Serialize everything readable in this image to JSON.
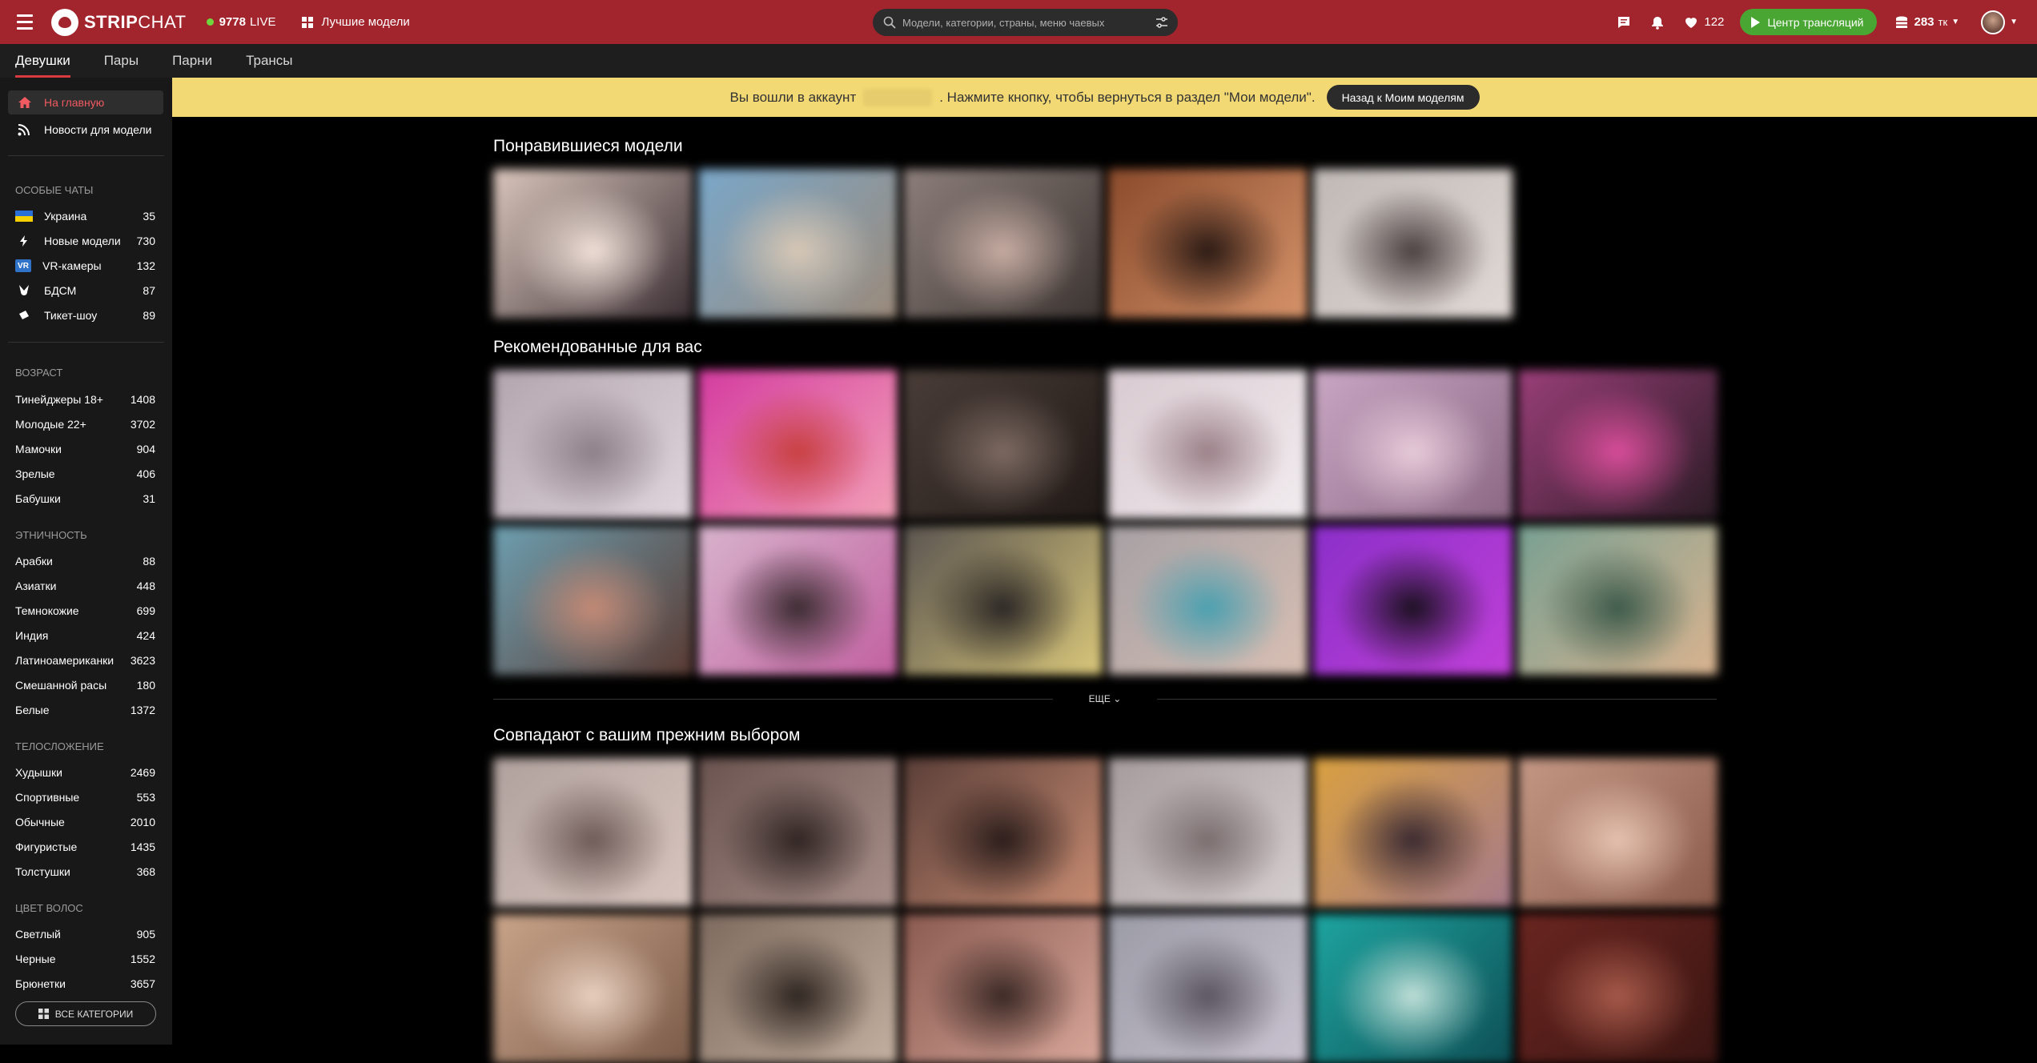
{
  "header": {
    "brand_bold": "STRIP",
    "brand_rest": "CHAT",
    "live_count": "9778",
    "live_label": "LIVE",
    "top_models": "Лучшие модели",
    "search_placeholder": "Модели, категории, страны, меню чаевых",
    "favorites_count": "122",
    "broadcast_button": "Центр трансляций",
    "tokens_count": "283",
    "tokens_unit": "тк"
  },
  "subnav": {
    "tabs": [
      "Девушки",
      "Пары",
      "Парни",
      "Трансы"
    ],
    "active": 0
  },
  "sidebar": {
    "home": "На главную",
    "news": "Новости для модели",
    "special_header": "Особые чаты",
    "special": [
      {
        "label": "Украина",
        "count": "35",
        "icon": "ukraine-flag-icon"
      },
      {
        "label": "Новые модели",
        "count": "730",
        "icon": "lightning-icon"
      },
      {
        "label": "VR-камеры",
        "count": "132",
        "icon": "vr-icon"
      },
      {
        "label": "БДСМ",
        "count": "87",
        "icon": "bdsm-icon"
      },
      {
        "label": "Тикет-шоу",
        "count": "89",
        "icon": "ticket-icon"
      }
    ],
    "age_header": "Возраст",
    "age": [
      {
        "label": "Тинейджеры 18+",
        "count": "1408"
      },
      {
        "label": "Молодые 22+",
        "count": "3702"
      },
      {
        "label": "Мамочки",
        "count": "904"
      },
      {
        "label": "Зрелые",
        "count": "406"
      },
      {
        "label": "Бабушки",
        "count": "31"
      }
    ],
    "ethnicity_header": "Этничность",
    "ethnicity": [
      {
        "label": "Арабки",
        "count": "88"
      },
      {
        "label": "Азиатки",
        "count": "448"
      },
      {
        "label": "Темнокожие",
        "count": "699"
      },
      {
        "label": "Индия",
        "count": "424"
      },
      {
        "label": "Латиноамериканки",
        "count": "3623"
      },
      {
        "label": "Смешанной расы",
        "count": "180"
      },
      {
        "label": "Белые",
        "count": "1372"
      }
    ],
    "body_header": "Телосложение",
    "body": [
      {
        "label": "Худышки",
        "count": "2469"
      },
      {
        "label": "Спортивные",
        "count": "553"
      },
      {
        "label": "Обычные",
        "count": "2010"
      },
      {
        "label": "Фигуристые",
        "count": "1435"
      },
      {
        "label": "Толстушки",
        "count": "368"
      }
    ],
    "hair_header": "Цвет волос",
    "hair": [
      {
        "label": "Светлый",
        "count": "905"
      },
      {
        "label": "Черные",
        "count": "1552"
      },
      {
        "label": "Брюнетки",
        "count": "3657"
      }
    ],
    "all_categories": "Все категории"
  },
  "banner": {
    "text_before": "Вы вошли в аккаунт",
    "text_after": ". Нажмите кнопку, чтобы вернуться в раздел \"Мои модели\".",
    "button": "Назад к Моим моделям"
  },
  "main": {
    "liked_title": "Понравившиеся модели",
    "recommended_title": "Рекомендованные для вас",
    "more_label": "ЕЩЕ",
    "matches_title": "Совпадают с вашим прежним выбором",
    "liked_colors": [
      [
        "#d9c5bb",
        "#3a2e33",
        "#f0e0d8"
      ],
      [
        "#7aa7c9",
        "#9b8a7a",
        "#d7c8b6"
      ],
      [
        "#8d7f7b",
        "#3b3431",
        "#c7aca2"
      ],
      [
        "#8a4b2c",
        "#d6936a",
        "#2b1a14"
      ],
      [
        "#bfb8b4",
        "#e1d9d5",
        "#4a4040"
      ]
    ],
    "recommended_colors": [
      [
        "#b3a5ae",
        "#e1d6dd",
        "#8d7f87"
      ],
      [
        "#d43ca0",
        "#f2a0b6",
        "#c84040"
      ],
      [
        "#4a3d38",
        "#201916",
        "#7d6a62"
      ],
      [
        "#d8cad0",
        "#f2ecef",
        "#9b8088"
      ],
      [
        "#c9a7c4",
        "#8b6784",
        "#e7cbd9"
      ],
      [
        "#9a3f79",
        "#2a1b24",
        "#d84d99"
      ],
      [
        "#6d9fb0",
        "#5a3a32",
        "#c48a76"
      ],
      [
        "#d7b3cc",
        "#c260a0",
        "#3b2b30"
      ],
      [
        "#5a5450",
        "#d9c77a",
        "#2b2725"
      ],
      [
        "#a6a0a4",
        "#d9bfb3",
        "#4aa0b0"
      ],
      [
        "#8b2fc9",
        "#c040d8",
        "#1b1020"
      ],
      [
        "#78a092",
        "#d9b38f",
        "#3d5a4a"
      ]
    ],
    "matches_colors": [
      [
        "#b0a19d",
        "#d9c5bf",
        "#6d5a56"
      ],
      [
        "#6b5450",
        "#a9908b",
        "#2f2422"
      ],
      [
        "#5a3e38",
        "#c98d73",
        "#2a1c1a"
      ],
      [
        "#a59b9c",
        "#d6cfd0",
        "#7a6d6e"
      ],
      [
        "#d9a040",
        "#a67a8a",
        "#3b2a30"
      ],
      [
        "#c49784",
        "#8a5a4a",
        "#e6c2b0"
      ],
      [
        "#c9a48a",
        "#7a5a48",
        "#e8d0c0"
      ],
      [
        "#7d6a5e",
        "#c4b0a0",
        "#2e2520"
      ],
      [
        "#8a5a50",
        "#d9a79a",
        "#3a2824"
      ],
      [
        "#9b9ba6",
        "#c9c3d0",
        "#5a5560"
      ],
      [
        "#1ea5a0",
        "#0d4f55",
        "#c0e0d8"
      ],
      [
        "#6a2520",
        "#3a1512",
        "#a65a4a"
      ]
    ]
  }
}
